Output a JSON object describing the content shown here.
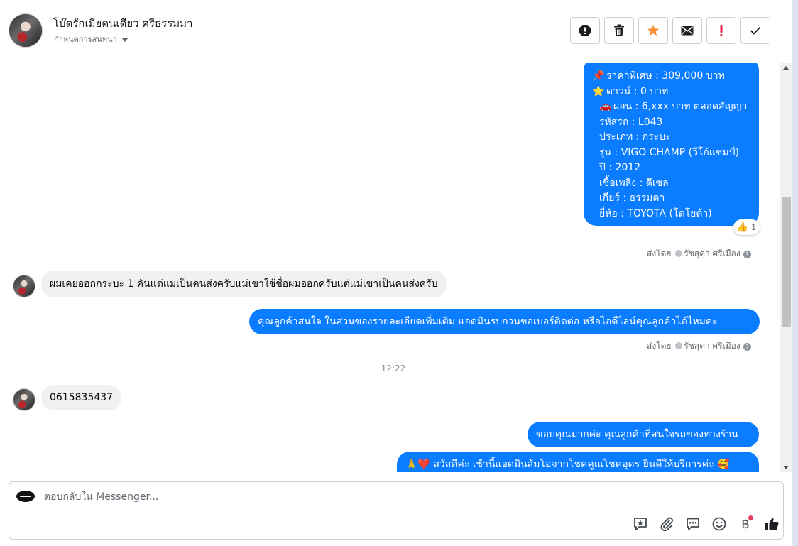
{
  "header": {
    "contact_name": "โบ๊ดรักเมียคนเดียว ศรีธรรมมา",
    "assign_label": "กำหนดการสนทนา",
    "toolbar": [
      {
        "icon": "spam-icon",
        "label": "!"
      },
      {
        "icon": "trash-icon",
        "label": ""
      },
      {
        "icon": "star-icon",
        "label": ""
      },
      {
        "icon": "envelope-icon",
        "label": ""
      },
      {
        "icon": "important-icon",
        "label": "!"
      },
      {
        "icon": "check-icon",
        "label": ""
      }
    ]
  },
  "thread": {
    "car_card": {
      "lines": [
        {
          "emoji": "📌",
          "text": "ราคาพิเศษ : 309,000 บาท"
        },
        {
          "emoji": "⭐",
          "text": "ดาวน์ : 0 บาท"
        },
        {
          "emoji": "🚗",
          "text": "ผ่อน : 6,xxx บาท ตลอดสัญญา"
        },
        {
          "emoji": "",
          "text": "รหัสรถ : L043"
        },
        {
          "emoji": "",
          "text": "ประเภท : กระบะ"
        },
        {
          "emoji": "",
          "text": "รุ่น : VIGO CHAMP (วีโก้แชมป์)"
        },
        {
          "emoji": "",
          "text": "ปี : 2012"
        },
        {
          "emoji": "",
          "text": "เชื้อเพลิง : ดีเซล"
        },
        {
          "emoji": "",
          "text": "เกียร์ : ธรรมดา"
        },
        {
          "emoji": "",
          "text": "ยี่ห้อ : TOYOTA (โตโยต้า)"
        }
      ],
      "reaction_count": "1"
    },
    "sent_by_1": {
      "prefix": "ส่งโดย",
      "agent": "รัชสุดา ศรีเมือง"
    },
    "incoming_1": "ผมเคยออกกระบะ 1 คันแต่แม่เป็นคนส่งครับแม่เขาใช้ชื่อผมออกครับแต่แม่เขาเป็นคนส่งครับ",
    "outgoing_1": "คุณลูกค้าสนใจ ในส่วนของรายละเอียดเพิ่มเติม แอดมินรบกวนขอเบอร์ติดต่อ หรือไอดีไลน์คุณลูกค้าได้ไหมคะ",
    "sent_by_2": {
      "prefix": "ส่งโดย",
      "agent": "รัชสุดา ศรีเมือง"
    },
    "timestamp": "12:22",
    "incoming_2": "0615835437",
    "outgoing_2": "ขอบคุณมากค่ะ คุณลูกค้าที่สนใจรถของทางร้าน",
    "outgoing_3": {
      "emoji_lead": "🙏❤️",
      "text": "สวัสดีค่ะ เช้านี้แอดมินส้มโอจากโชคคูณโชคอุดร ยินดีให้บริการค่ะ",
      "emoji_trail": "🥰"
    }
  },
  "composer": {
    "placeholder": "ตอบกลับใน Messenger...",
    "tools": [
      "sticker-icon",
      "attachment-icon",
      "saved-replies-icon",
      "emoji-icon",
      "payment-baht-icon",
      "like-icon"
    ],
    "baht_symbol": "฿"
  },
  "colors": {
    "outgoing_bubble": "#0a7cff",
    "incoming_bubble": "#f0f0f0",
    "star_button": "#f7923a",
    "important_button": "#e41e3f"
  }
}
